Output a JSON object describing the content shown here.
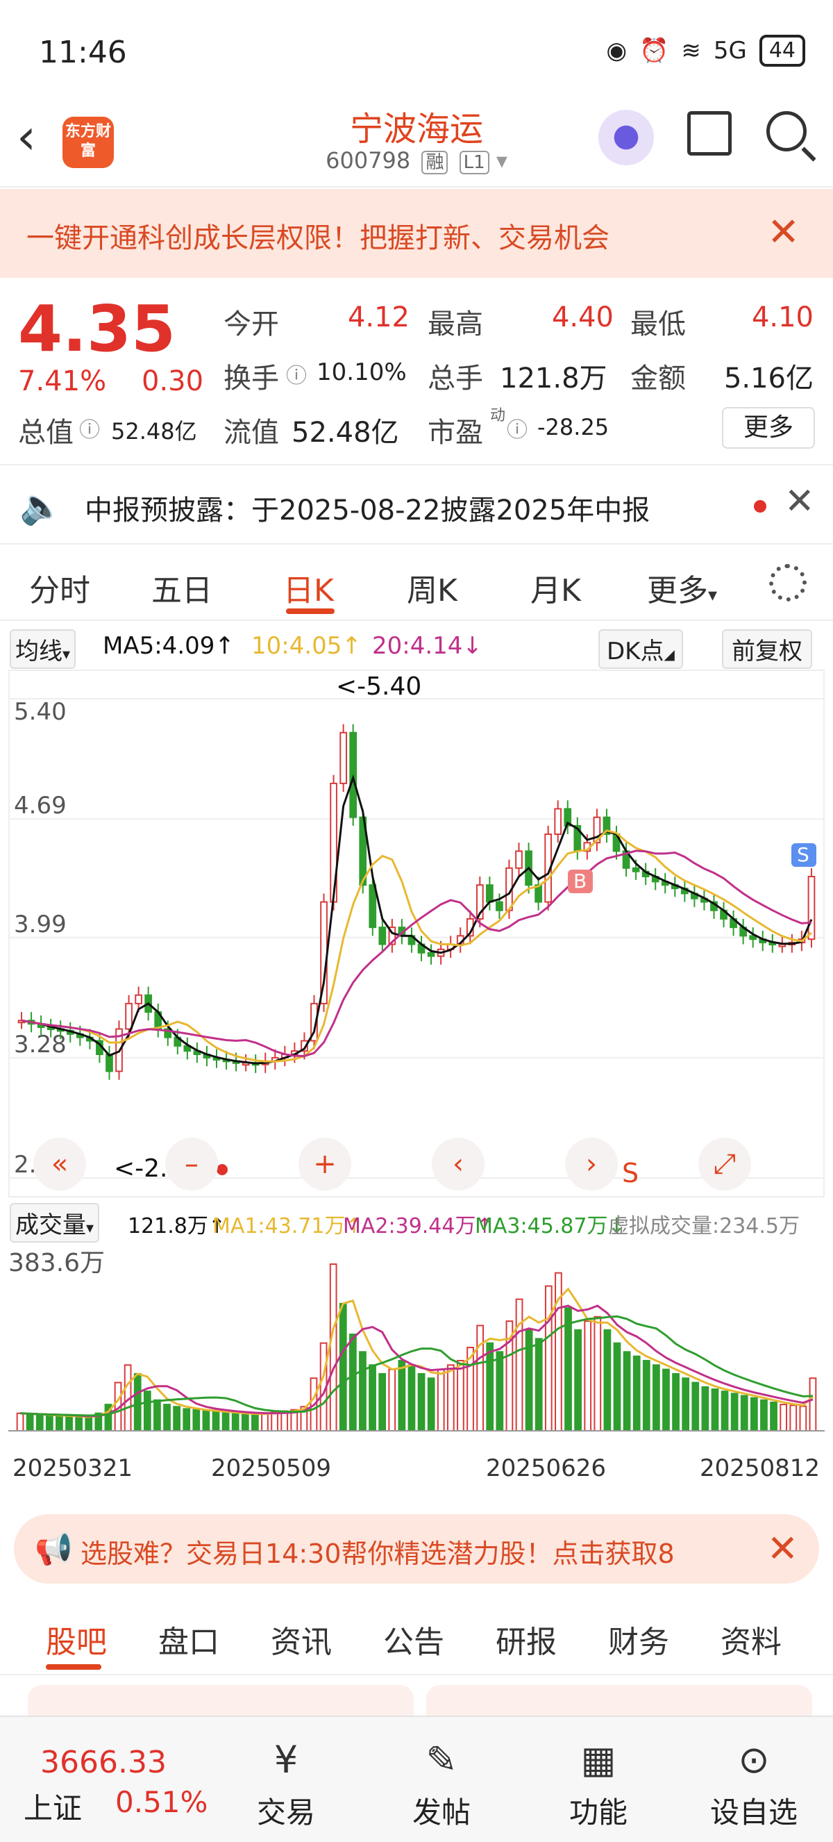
{
  "status_bar": {
    "time": "11:46",
    "battery": "44",
    "network": "5G"
  },
  "header": {
    "logo_text": "东方财富",
    "stock_name": "宁波海运",
    "stock_code": "600798",
    "tag_rong": "融",
    "tag_level": "L1"
  },
  "promo_banner": {
    "text": "一键开通科创成长层权限！把握打新、交易机会"
  },
  "quote": {
    "price": "4.35",
    "change_pct": "7.41%",
    "change_amt": "0.30",
    "open_label": "今开",
    "open": "4.12",
    "high_label": "最高",
    "high": "4.40",
    "low_label": "最低",
    "low": "4.10",
    "turnover_label": "换手",
    "turnover": "10.10%",
    "volume_label": "总手",
    "volume": "121.8万",
    "amount_label": "金额",
    "amount": "5.16亿",
    "mktcap_label": "总值",
    "mktcap": "52.48亿",
    "float_label": "流值",
    "float": "52.48亿",
    "pe_label": "市盈",
    "pe_sup": "动",
    "pe": "-28.25",
    "more_label": "更多"
  },
  "notice": {
    "text": "中报预披露：于2025-08-22披露2025年中报"
  },
  "kline_tabs": [
    "分时",
    "五日",
    "日K",
    "周K",
    "月K",
    "更多"
  ],
  "active_tab": "日K",
  "ma_legend": {
    "select": "均线",
    "ma5": "MA5:4.09↑",
    "ma10": "10:4.05↑",
    "ma20": "20:4.14↓",
    "dk": "DK点",
    "adjust": "前复权",
    "colors": {
      "ma5": "#111111",
      "ma10": "#e8b830",
      "ma20": "#c0308a",
      "up": "#d93a3a",
      "down": "#2e9e2e"
    }
  },
  "chart_data": {
    "type": "candlestick",
    "y_ticks": [
      "5.40",
      "4.69",
      "3.99",
      "3.28",
      "2.57"
    ],
    "ylim": [
      2.57,
      5.4
    ],
    "max_label": "<-5.40",
    "min_label": "<-2.57",
    "buy_marker": "B",
    "sell_marker": "S",
    "sell_marker2": "S",
    "x_dates": [
      "20250321",
      "20250509",
      "20250626",
      "20250812"
    ],
    "close_approx": [
      3.5,
      3.48,
      3.46,
      3.45,
      3.44,
      3.42,
      3.4,
      3.38,
      3.3,
      3.2,
      3.45,
      3.6,
      3.65,
      3.55,
      3.45,
      3.4,
      3.35,
      3.32,
      3.3,
      3.28,
      3.27,
      3.26,
      3.25,
      3.25,
      3.24,
      3.26,
      3.28,
      3.3,
      3.32,
      3.38,
      3.6,
      4.2,
      4.9,
      5.2,
      4.7,
      4.3,
      4.05,
      3.95,
      4.05,
      4.0,
      3.95,
      3.9,
      3.88,
      3.92,
      3.95,
      4.0,
      4.1,
      4.3,
      4.2,
      4.15,
      4.4,
      4.5,
      4.3,
      4.2,
      4.6,
      4.75,
      4.65,
      4.5,
      4.55,
      4.7,
      4.6,
      4.5,
      4.4,
      4.38,
      4.35,
      4.32,
      4.3,
      4.28,
      4.25,
      4.22,
      4.2,
      4.15,
      4.1,
      4.05,
      4.0,
      3.98,
      3.96,
      3.95,
      3.95,
      3.96,
      3.98,
      4.35
    ]
  },
  "volume_legend": {
    "select": "成交量",
    "vol": "121.8万↑",
    "ma1": "MA1:43.71万↑",
    "ma2": "MA2:39.44万↑",
    "ma3": "MA3:45.87万↓",
    "virtual": "虚拟成交量:234.5万"
  },
  "volume_chart": {
    "max_label": "383.6万",
    "values": [
      40,
      38,
      36,
      35,
      34,
      33,
      32,
      30,
      40,
      60,
      110,
      150,
      130,
      90,
      70,
      60,
      55,
      50,
      48,
      45,
      44,
      42,
      40,
      38,
      38,
      40,
      42,
      45,
      48,
      55,
      120,
      200,
      380,
      290,
      220,
      180,
      150,
      130,
      140,
      160,
      150,
      130,
      120,
      140,
      150,
      160,
      190,
      240,
      200,
      180,
      250,
      300,
      230,
      210,
      330,
      360,
      280,
      230,
      250,
      260,
      230,
      200,
      180,
      170,
      160,
      150,
      140,
      130,
      120,
      110,
      100,
      95,
      90,
      85,
      80,
      75,
      70,
      65,
      60,
      58,
      56,
      120
    ],
    "up": [
      1,
      0,
      0,
      0,
      0,
      0,
      0,
      0,
      0,
      0,
      1,
      1,
      0,
      0,
      0,
      0,
      0,
      0,
      0,
      0,
      0,
      0,
      0,
      0,
      0,
      1,
      1,
      1,
      1,
      1,
      1,
      1,
      1,
      0,
      0,
      0,
      0,
      0,
      1,
      0,
      0,
      0,
      0,
      1,
      1,
      1,
      1,
      1,
      0,
      0,
      1,
      1,
      0,
      0,
      1,
      1,
      0,
      0,
      1,
      1,
      0,
      0,
      0,
      0,
      0,
      0,
      0,
      0,
      0,
      0,
      0,
      0,
      0,
      0,
      0,
      0,
      0,
      0,
      1,
      1,
      1,
      1
    ]
  },
  "chart_controls": [
    "«",
    "–",
    "+",
    "‹",
    "›",
    "⤢"
  ],
  "bottom_promo": {
    "text": "选股难？交易日14:30帮你精选潜力股！点击获取8"
  },
  "sub_tabs": [
    "股吧",
    "盘口",
    "资讯",
    "公告",
    "研报",
    "财务",
    "资料"
  ],
  "bottom_nav": {
    "index_value": "3666.33",
    "index_name": "上证",
    "index_change": "0.51%",
    "items": [
      {
        "label": "交易",
        "icon": "trade-icon"
      },
      {
        "label": "发帖",
        "icon": "post-icon"
      },
      {
        "label": "功能",
        "icon": "apps-icon"
      },
      {
        "label": "设自选",
        "icon": "favorite-icon"
      }
    ]
  }
}
